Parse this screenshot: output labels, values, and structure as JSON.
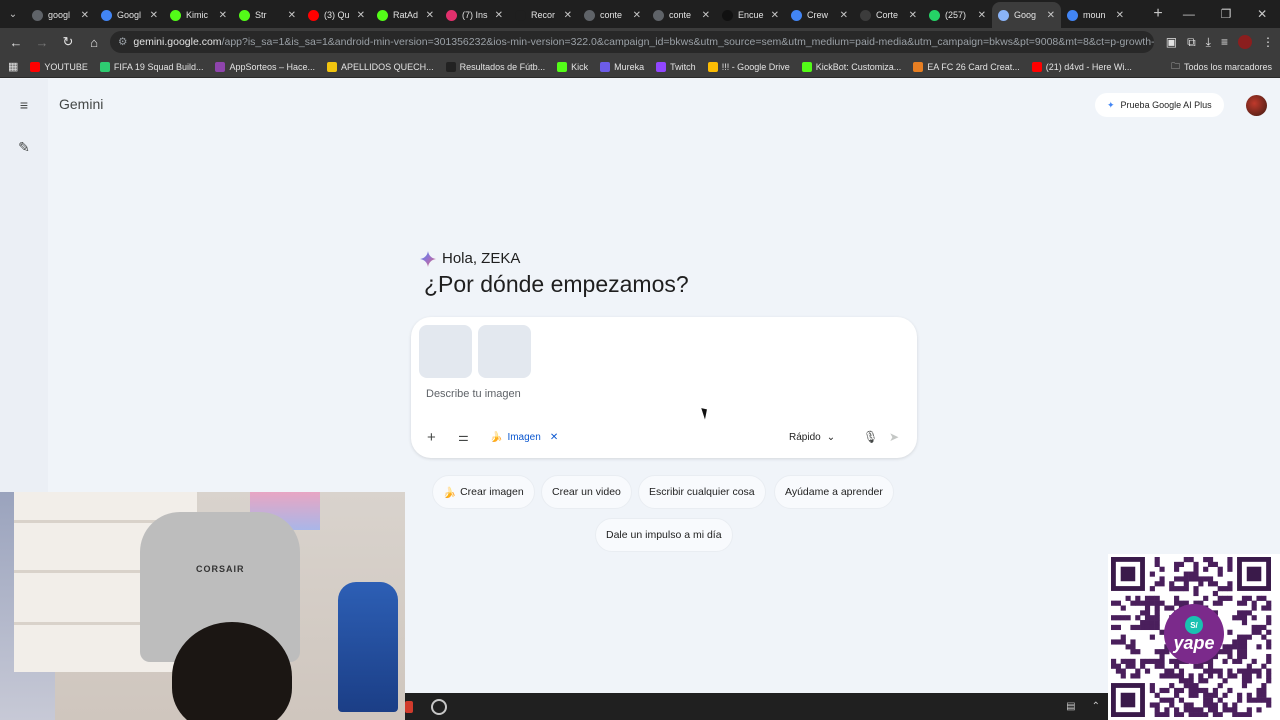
{
  "browser": {
    "tabs": [
      {
        "title": "googl",
        "color": "#5f6368",
        "active": false
      },
      {
        "title": "Googl",
        "color": "#4285f4",
        "active": false
      },
      {
        "title": "Kimic",
        "color": "#53fc18",
        "active": false
      },
      {
        "title": "Str",
        "color": "#53fc18",
        "active": false
      },
      {
        "title": "(3) Qu",
        "color": "#ff0000",
        "active": false
      },
      {
        "title": "RatAd",
        "color": "#53fc18",
        "active": false
      },
      {
        "title": "(7) Ins",
        "color": "#e1306c",
        "active": false
      },
      {
        "title": "Recor",
        "color": "#1f1f1f",
        "active": false
      },
      {
        "title": "conte",
        "color": "#5f6368",
        "active": false
      },
      {
        "title": "conte",
        "color": "#5f6368",
        "active": false
      },
      {
        "title": "Encue",
        "color": "#111111",
        "active": false
      },
      {
        "title": "Crew",
        "color": "#4285f4",
        "active": false
      },
      {
        "title": "Corte",
        "color": "#3c3c3c",
        "active": false
      },
      {
        "title": "(257)",
        "color": "#25d366",
        "active": false
      },
      {
        "title": "Goog",
        "color": "#8ab4f8",
        "active": true
      },
      {
        "title": "moun",
        "color": "#4285f4",
        "active": false
      }
    ],
    "url_host": "gemini.google.com",
    "url_path": "/app?is_sa=1&is_sa=1&android-min-version=301356232&ios-min-version=322.0&campaign_id=bkws&utm_source=sem&utm_medium=paid-media&utm_campaign=bkws&pt=9008&mt=8&ct=p-growth-sem-...",
    "bookmarks": [
      {
        "label": "YOUTUBE",
        "color": "#ff0000"
      },
      {
        "label": "FIFA 19 Squad Build...",
        "color": "#2ecc71"
      },
      {
        "label": "AppSorteos – Hace...",
        "color": "#8e44ad"
      },
      {
        "label": "APELLIDOS QUECH...",
        "color": "#f1c40f"
      },
      {
        "label": "Resultados de Fútb...",
        "color": "#222222"
      },
      {
        "label": "Kick",
        "color": "#53fc18"
      },
      {
        "label": "Mureka",
        "color": "#6c5ce7"
      },
      {
        "label": "Twitch",
        "color": "#9146ff"
      },
      {
        "label": "!!! - Google Drive",
        "color": "#fbbc04"
      },
      {
        "label": "KickBot: Customiza...",
        "color": "#53fc18"
      },
      {
        "label": "EA FC 26 Card Creat...",
        "color": "#e67e22"
      },
      {
        "label": "(21) d4vd - Here Wi...",
        "color": "#ff0000"
      }
    ],
    "bookmarks_all": "Todos los marcadores"
  },
  "app": {
    "brand": "Gemini",
    "try_plus": "Prueba Google AI Plus",
    "greeting": "Hola, ZEKA",
    "headline": "¿Por dónde empezamos?",
    "composer": {
      "placeholder": "Describe tu imagen",
      "tool_chip": "Imagen",
      "mode": "Rápido"
    },
    "suggestions": [
      {
        "label": "Crear imagen",
        "emoji": "🍌"
      },
      {
        "label": "Crear un video",
        "emoji": ""
      },
      {
        "label": "Escribir cualquier cosa",
        "emoji": ""
      },
      {
        "label": "Ayúdame a aprender",
        "emoji": ""
      },
      {
        "label": "Dale un impulso a mi día",
        "emoji": ""
      }
    ]
  },
  "overlay": {
    "chair_brand": "CORSAIR",
    "qr_badge_mark": "S/",
    "qr_badge_text": "yape"
  }
}
